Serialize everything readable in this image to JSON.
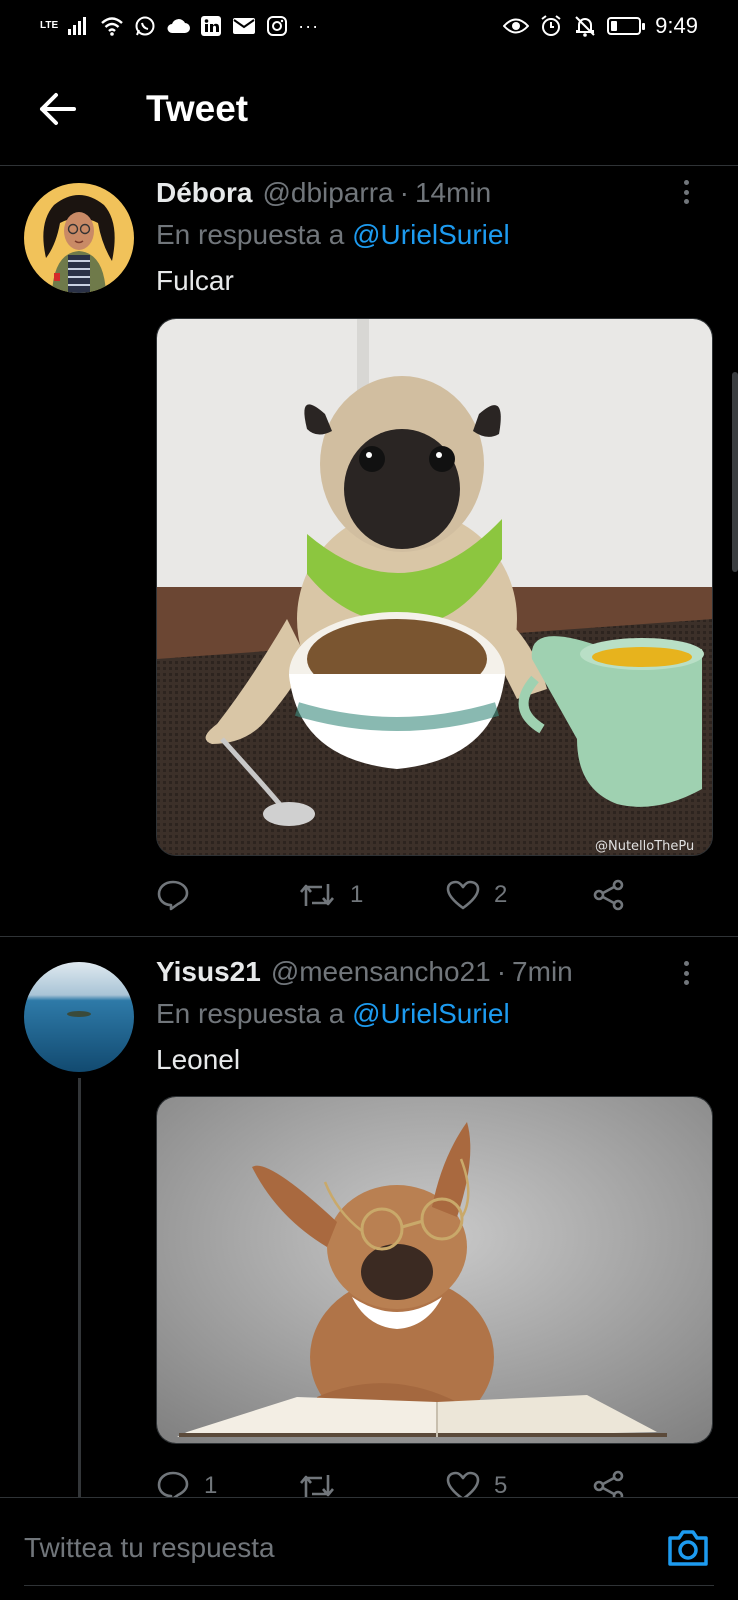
{
  "status_bar": {
    "network": "LTE",
    "time": "9:49",
    "overflow": "···",
    "battery_level": 0.22
  },
  "header": {
    "title": "Tweet"
  },
  "tweets": [
    {
      "name": "Débora",
      "handle": "@dbiparra",
      "separator": "·",
      "time": "14min",
      "reply_prefix": "En respuesta a",
      "reply_to": "@UrielSuriel",
      "text": "Fulcar",
      "image_watermark": "@NutelloThePu",
      "reply_count": "",
      "retweet_count": "1",
      "like_count": "2"
    },
    {
      "name": "Yisus21",
      "handle": "@meensancho21",
      "separator": "·",
      "time": "7min",
      "reply_prefix": "En respuesta a",
      "reply_to": "@UrielSuriel",
      "text": "Leonel",
      "reply_count": "1",
      "retweet_count": "",
      "like_count": "5"
    }
  ],
  "compose": {
    "placeholder": "Twittea tu respuesta"
  },
  "colors": {
    "background": "#000000",
    "accent": "#1d9bf0",
    "muted": "#71767b",
    "divider": "#2f3336"
  }
}
